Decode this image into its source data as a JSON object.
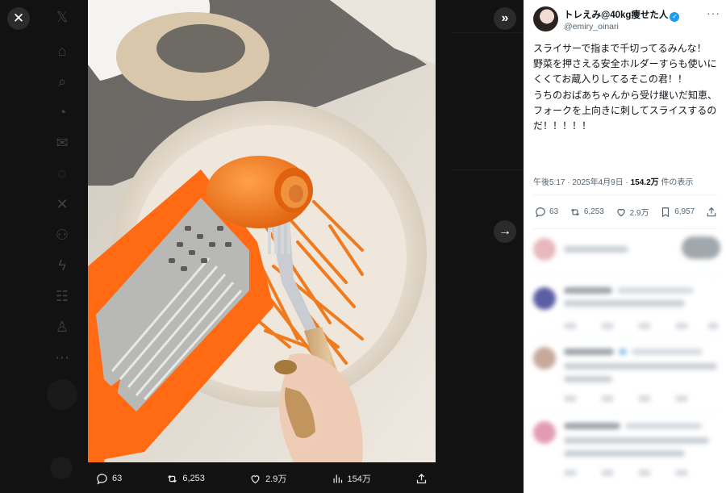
{
  "overlay": {
    "close_icon": "close-icon",
    "expand_icon": "double-chevron-right-icon",
    "next_icon": "arrow-right-icon",
    "actions": {
      "replies": "63",
      "retweets": "6,253",
      "likes": "2.9万",
      "views": "154万"
    }
  },
  "author": {
    "name": "トレえみ@40kg痩せた人",
    "handle": "@emiry_oinari",
    "verified": true
  },
  "tweet": {
    "text": "スライサーで指まで千切ってるみんな！\n野菜を押さえる安全ホルダーすらも使いにくくてお蔵入りしてるそこの君！！\nうちのおばあちゃんから受け継いだ知恵、フォークを上向きに刺してスライスするのだ！！！！！",
    "time": "午後5:17",
    "date": "2025年4月9日",
    "views_count": "154.2万",
    "views_label": "件の表示"
  },
  "stats": {
    "replies": "63",
    "retweets": "6,253",
    "likes": "2.9万",
    "bookmarks": "6,957"
  },
  "colors": {
    "accent": "#1d9bf0",
    "carrot": "#f07a1e",
    "slicer": "#ff6a13"
  }
}
